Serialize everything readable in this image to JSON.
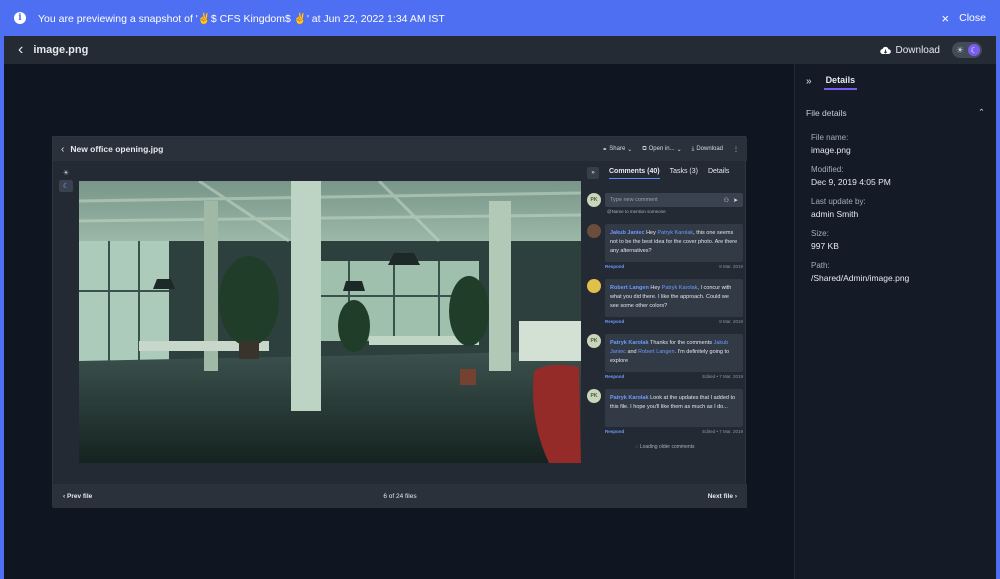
{
  "banner": {
    "message": "You are previewing a snapshot of '✌$ CFS Kingdom$ ✌' at Jun 22, 2022 1:34 AM IST",
    "close_label": "Close"
  },
  "topbar": {
    "title": "image.png",
    "download_label": "Download",
    "theme_toggle": {
      "light": "☀",
      "dark": "☾"
    }
  },
  "viewer": {
    "title": "New office opening.jpg",
    "actions": {
      "share": "Share",
      "open_in": "Open in...",
      "download": "Download"
    },
    "pagination": {
      "prev": "Prev file",
      "status": "6 of 24 files",
      "next": "Next file"
    },
    "comments_panel": {
      "tabs": [
        "Comments (40)",
        "Tasks (3)",
        "Details"
      ],
      "new_comment": {
        "avatar": "PK",
        "placeholder": "Type new comment",
        "hint": "@Name to mention someone"
      },
      "comments": [
        {
          "author": "Jakub Janiec",
          "text_pre": "Hey",
          "mention1": "Patryk Karolak",
          "text_mid": ", this one seems not to be the best idea for the cover photo. Are there any alternatives?",
          "respond": "Respond",
          "date": "8 Mar. 2019"
        },
        {
          "author": "Robert Langen",
          "text_pre": "Hey",
          "mention1": "Patryk Karolak",
          "text_mid": ", I concur with what you did there. I like the approach. Could we see some other colors?",
          "respond": "Respond",
          "date": "8 Mar. 2019"
        },
        {
          "author": "Patryk Karolak",
          "avatar": "PK",
          "text_pre": "Thanks for the comments",
          "mention1": "Jakub Janiec",
          "text_and": "and",
          "mention2": "Robert Langen",
          "text_post": ". I'm definitely going to explore",
          "respond": "Respond",
          "date": "Edited • 7 Mar. 2019"
        },
        {
          "author": "Patryk Karolak",
          "avatar": "PK",
          "text_pre": "Look at the updates that I added to this file. I hope you'll like them as much as I do...",
          "respond": "Respond",
          "date": "Edited • 7 Mar. 2019"
        }
      ],
      "loading": "Loading older comments"
    }
  },
  "details": {
    "tab": "Details",
    "section": "File details",
    "fields": [
      {
        "label": "File name:",
        "value": "image.png"
      },
      {
        "label": "Modified:",
        "value": "Dec 9, 2019 4:05 PM"
      },
      {
        "label": "Last update by:",
        "value": "admin Smith"
      },
      {
        "label": "Size:",
        "value": "997 KB"
      },
      {
        "label": "Path:",
        "value": "/Shared/Admin/image.png"
      }
    ]
  },
  "colors": {
    "banner": "#4f6ff3",
    "accent": "#7a5cf0",
    "link": "#6e9bff"
  }
}
